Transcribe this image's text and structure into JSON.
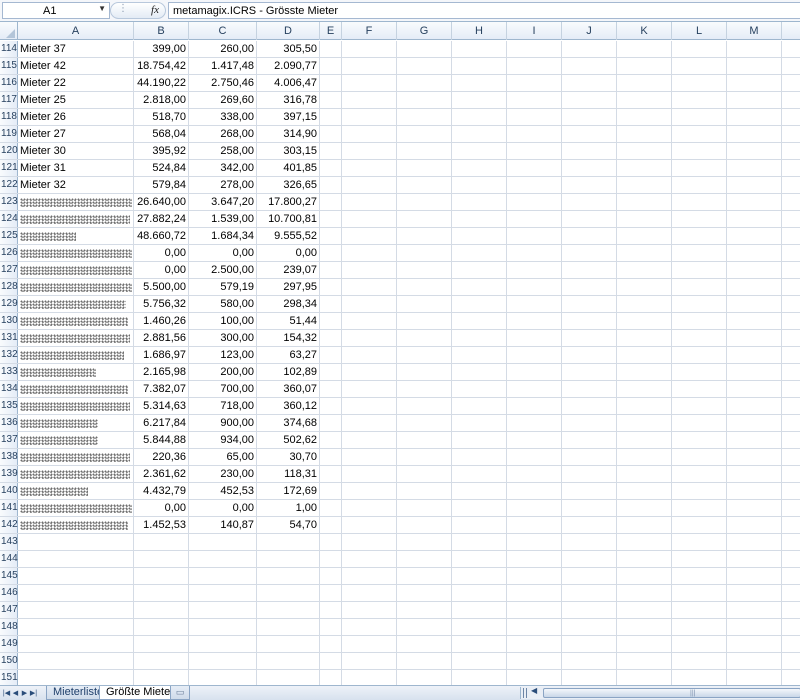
{
  "formula_bar": {
    "name_box": "A1",
    "fx_label": "fx",
    "formula": "metamagix.ICRS - Grösste Mieter"
  },
  "columns": [
    "A",
    "B",
    "C",
    "D",
    "E",
    "F",
    "G",
    "H",
    "I",
    "J",
    "K",
    "L",
    "M"
  ],
  "rows": [
    {
      "n": "114",
      "a": "Mieter 37",
      "b": "399,00",
      "c": "260,00",
      "d": "305,50"
    },
    {
      "n": "115",
      "a": "Mieter 42",
      "b": "18.754,42",
      "c": "1.417,48",
      "d": "2.090,77"
    },
    {
      "n": "116",
      "a": "Mieter 22",
      "b": "44.190,22",
      "c": "2.750,46",
      "d": "4.006,47"
    },
    {
      "n": "117",
      "a": "Mieter 25",
      "b": "2.818,00",
      "c": "269,60",
      "d": "316,78"
    },
    {
      "n": "118",
      "a": "Mieter 26",
      "b": "518,70",
      "c": "338,00",
      "d": "397,15"
    },
    {
      "n": "119",
      "a": "Mieter 27",
      "b": "568,04",
      "c": "268,00",
      "d": "314,90"
    },
    {
      "n": "120",
      "a": "Mieter 30",
      "b": "395,92",
      "c": "258,00",
      "d": "303,15"
    },
    {
      "n": "121",
      "a": "Mieter 31",
      "b": "524,84",
      "c": "342,00",
      "d": "401,85"
    },
    {
      "n": "122",
      "a": "Mieter 32",
      "b": "579,84",
      "c": "278,00",
      "d": "326,65"
    },
    {
      "n": "123",
      "a": "",
      "b": "26.640,00",
      "c": "3.647,20",
      "d": "17.800,27"
    },
    {
      "n": "124",
      "a": "",
      "b": "27.882,24",
      "c": "1.539,00",
      "d": "10.700,81"
    },
    {
      "n": "125",
      "a": "",
      "b": "48.660,72",
      "c": "1.684,34",
      "d": "9.555,52"
    },
    {
      "n": "126",
      "a": "",
      "b": "0,00",
      "c": "0,00",
      "d": "0,00"
    },
    {
      "n": "127",
      "a": "",
      "b": "0,00",
      "c": "2.500,00",
      "d": "239,07"
    },
    {
      "n": "128",
      "a": "",
      "b": "5.500,00",
      "c": "579,19",
      "d": "297,95"
    },
    {
      "n": "129",
      "a": "",
      "b": "5.756,32",
      "c": "580,00",
      "d": "298,34"
    },
    {
      "n": "130",
      "a": "",
      "b": "1.460,26",
      "c": "100,00",
      "d": "51,44"
    },
    {
      "n": "131",
      "a": "",
      "b": "2.881,56",
      "c": "300,00",
      "d": "154,32"
    },
    {
      "n": "132",
      "a": "",
      "b": "1.686,97",
      "c": "123,00",
      "d": "63,27"
    },
    {
      "n": "133",
      "a": "",
      "b": "2.165,98",
      "c": "200,00",
      "d": "102,89"
    },
    {
      "n": "134",
      "a": "",
      "b": "7.382,07",
      "c": "700,00",
      "d": "360,07"
    },
    {
      "n": "135",
      "a": "",
      "b": "5.314,63",
      "c": "718,00",
      "d": "360,12"
    },
    {
      "n": "136",
      "a": "",
      "b": "6.217,84",
      "c": "900,00",
      "d": "374,68"
    },
    {
      "n": "137",
      "a": "",
      "b": "5.844,88",
      "c": "934,00",
      "d": "502,62"
    },
    {
      "n": "138",
      "a": "",
      "b": "220,36",
      "c": "65,00",
      "d": "30,70"
    },
    {
      "n": "139",
      "a": "",
      "b": "2.361,62",
      "c": "230,00",
      "d": "118,31"
    },
    {
      "n": "140",
      "a": "",
      "b": "4.432,79",
      "c": "452,53",
      "d": "172,69"
    },
    {
      "n": "141",
      "a": "",
      "b": "0,00",
      "c": "0,00",
      "d": "1,00"
    },
    {
      "n": "142",
      "a": "",
      "b": "1.452,53",
      "c": "140,87",
      "d": "54,70"
    },
    {
      "n": "143",
      "a": "",
      "b": "",
      "c": "",
      "d": ""
    },
    {
      "n": "144",
      "a": "",
      "b": "",
      "c": "",
      "d": ""
    },
    {
      "n": "145",
      "a": "",
      "b": "",
      "c": "",
      "d": ""
    },
    {
      "n": "146",
      "a": "",
      "b": "",
      "c": "",
      "d": ""
    },
    {
      "n": "147",
      "a": "",
      "b": "",
      "c": "",
      "d": ""
    },
    {
      "n": "148",
      "a": "",
      "b": "",
      "c": "",
      "d": ""
    },
    {
      "n": "149",
      "a": "",
      "b": "",
      "c": "",
      "d": ""
    },
    {
      "n": "150",
      "a": "",
      "b": "",
      "c": "",
      "d": ""
    },
    {
      "n": "151",
      "a": "",
      "b": "",
      "c": "",
      "d": ""
    }
  ],
  "sheet_tabs": [
    "Mieterliste",
    "Größte Mieter"
  ],
  "active_tab": "Größte Mieter",
  "colors": {
    "header_bg": "#e4ecf7",
    "grid_line": "#d4dbe5",
    "header_border": "#9eb6ce"
  }
}
